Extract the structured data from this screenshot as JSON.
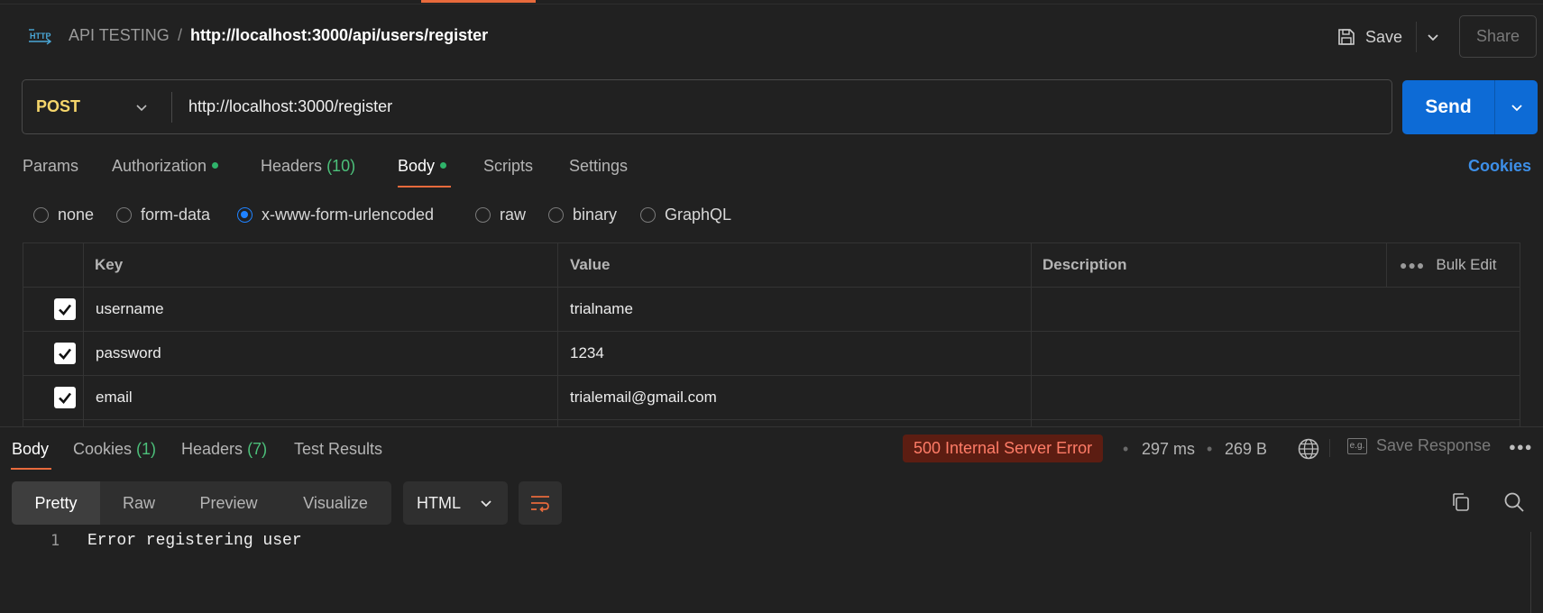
{
  "header": {
    "collection": "API TESTING",
    "separator": "/",
    "request_name": "http://localhost:3000/api/users/register",
    "save_label": "Save",
    "share_label": "Share"
  },
  "request": {
    "method": "POST",
    "url": "http://localhost:3000/register",
    "send_label": "Send"
  },
  "request_tabs": [
    {
      "label": "Params"
    },
    {
      "label": "Authorization",
      "dot": true
    },
    {
      "label": "Headers",
      "count": "(10)"
    },
    {
      "label": "Body",
      "dot": true,
      "active": true
    },
    {
      "label": "Scripts"
    },
    {
      "label": "Settings"
    }
  ],
  "cookies_link": "Cookies",
  "body_types": [
    {
      "label": "none",
      "checked": false
    },
    {
      "label": "form-data",
      "checked": false
    },
    {
      "label": "x-www-form-urlencoded",
      "checked": true
    },
    {
      "label": "raw",
      "checked": false
    },
    {
      "label": "binary",
      "checked": false
    },
    {
      "label": "GraphQL",
      "checked": false
    }
  ],
  "table": {
    "headers": {
      "key": "Key",
      "value": "Value",
      "description": "Description"
    },
    "bulk_edit": "Bulk Edit",
    "rows": [
      {
        "checked": true,
        "key": "username",
        "value": "trialname",
        "description": ""
      },
      {
        "checked": true,
        "key": "password",
        "value": "1234",
        "description": ""
      },
      {
        "checked": true,
        "key": "email",
        "value": "trialemail@gmail.com",
        "description": ""
      }
    ]
  },
  "response": {
    "tabs": [
      {
        "label": "Body",
        "active": true
      },
      {
        "label": "Cookies",
        "count": "(1)"
      },
      {
        "label": "Headers",
        "count": "(7)"
      },
      {
        "label": "Test Results"
      }
    ],
    "status": "500 Internal Server Error",
    "time": "297 ms",
    "size": "269 B",
    "save_response": "Save Response",
    "views": [
      "Pretty",
      "Raw",
      "Preview",
      "Visualize"
    ],
    "format": "HTML",
    "lines": [
      {
        "number": "1",
        "text": "Error registering user"
      }
    ]
  },
  "colors": {
    "accent": "#e86a3c",
    "send": "#0d6bd6",
    "method": "#f6d66b",
    "status_error_bg": "#5c1d12",
    "status_error_text": "#ff7c67",
    "dot": "#2fb36a"
  }
}
